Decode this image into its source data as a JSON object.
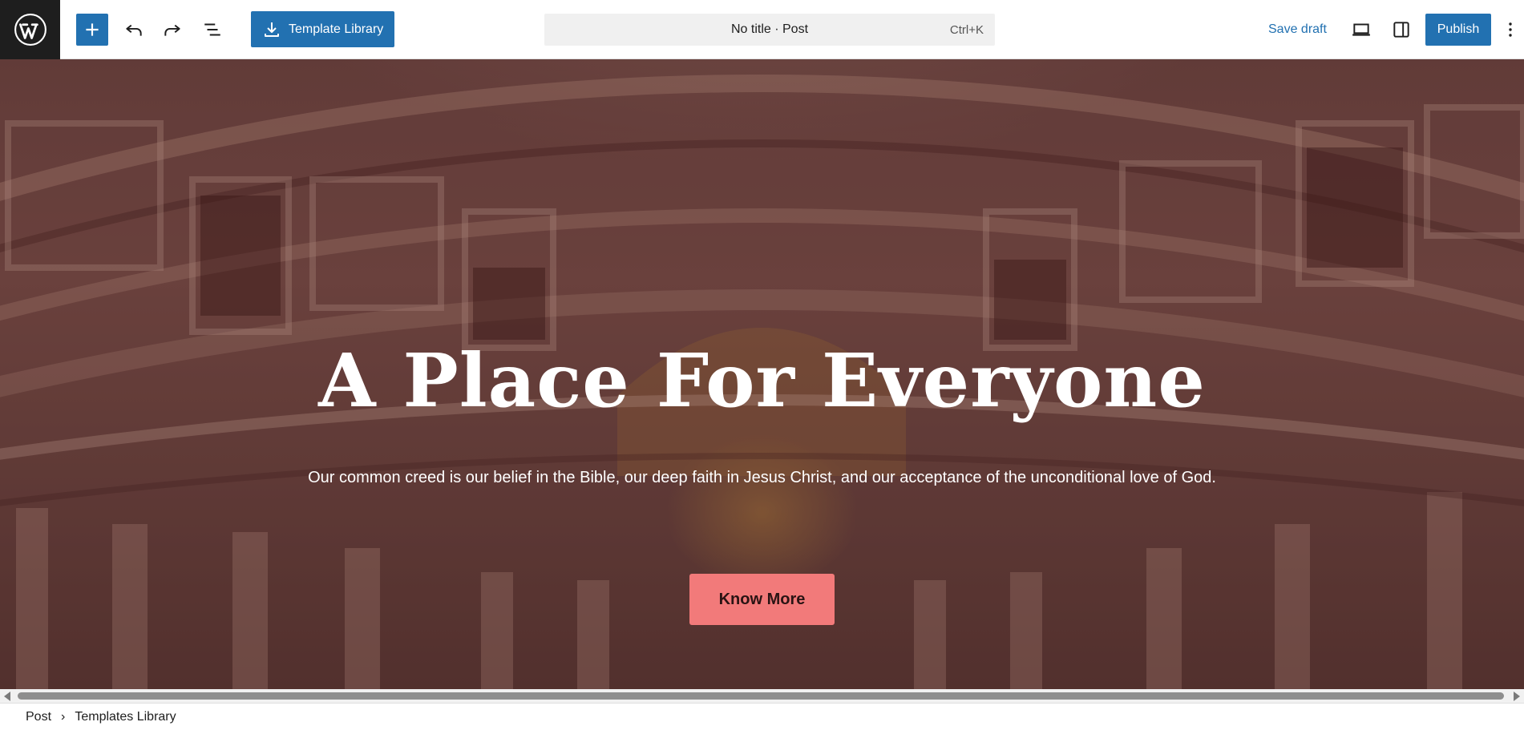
{
  "toolbar": {
    "template_library_label": "Template Library",
    "document_title": "No title · Post",
    "shortcut": "Ctrl+K",
    "save_draft_label": "Save draft",
    "publish_label": "Publish",
    "accent_color": "#2271b1"
  },
  "hero": {
    "title": "A Place For Everyone",
    "subtitle": "Our common creed is our belief in the Bible, our deep faith in Jesus Christ, and our acceptance of the unconditional love of God.",
    "button_label": "Know More",
    "button_color": "#f27a7a"
  },
  "breadcrumb": {
    "items": [
      "Post",
      "Templates Library"
    ],
    "separator": "›"
  }
}
